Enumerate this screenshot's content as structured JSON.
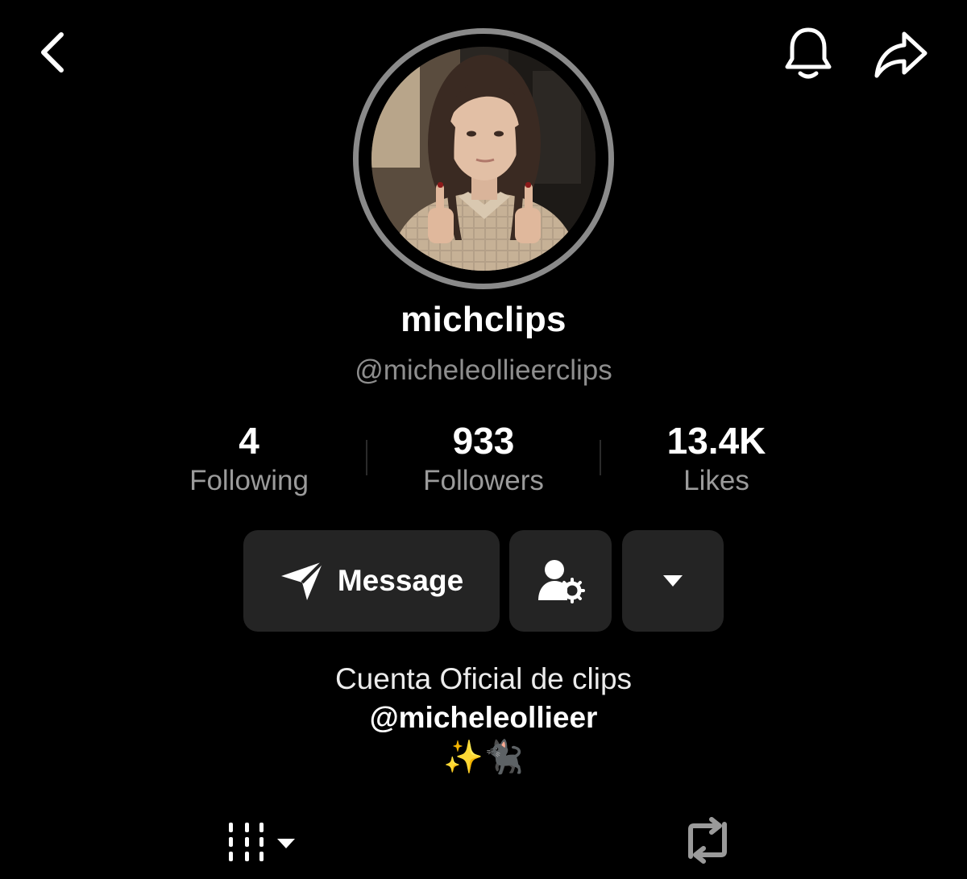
{
  "header": {
    "back_icon": "chevron-left-icon",
    "notification_icon": "bell-icon",
    "share_icon": "share-arrow-icon"
  },
  "profile": {
    "display_name": "michclips",
    "username": "@micheleollieerclips",
    "avatar": "profile-photo"
  },
  "stats": [
    {
      "value": "4",
      "label": "Following"
    },
    {
      "value": "933",
      "label": "Followers"
    },
    {
      "value": "13.4K",
      "label": "Likes"
    }
  ],
  "actions": {
    "message_label": "Message",
    "message_icon": "paper-plane-icon",
    "friends_icon": "user-settings-icon",
    "more_icon": "caret-down-icon"
  },
  "bio": {
    "line1": "Cuenta Oficial de clips",
    "line2": "@micheleollieer",
    "line3": "✨🐈‍⬛"
  },
  "tabs": {
    "videos_icon": "grid-columns-icon",
    "reposts_icon": "repost-icon"
  },
  "colors": {
    "background": "#000000",
    "button_bg": "#242424",
    "secondary_text": "#8e8e8e",
    "avatar_ring": "#8a8a8a"
  }
}
